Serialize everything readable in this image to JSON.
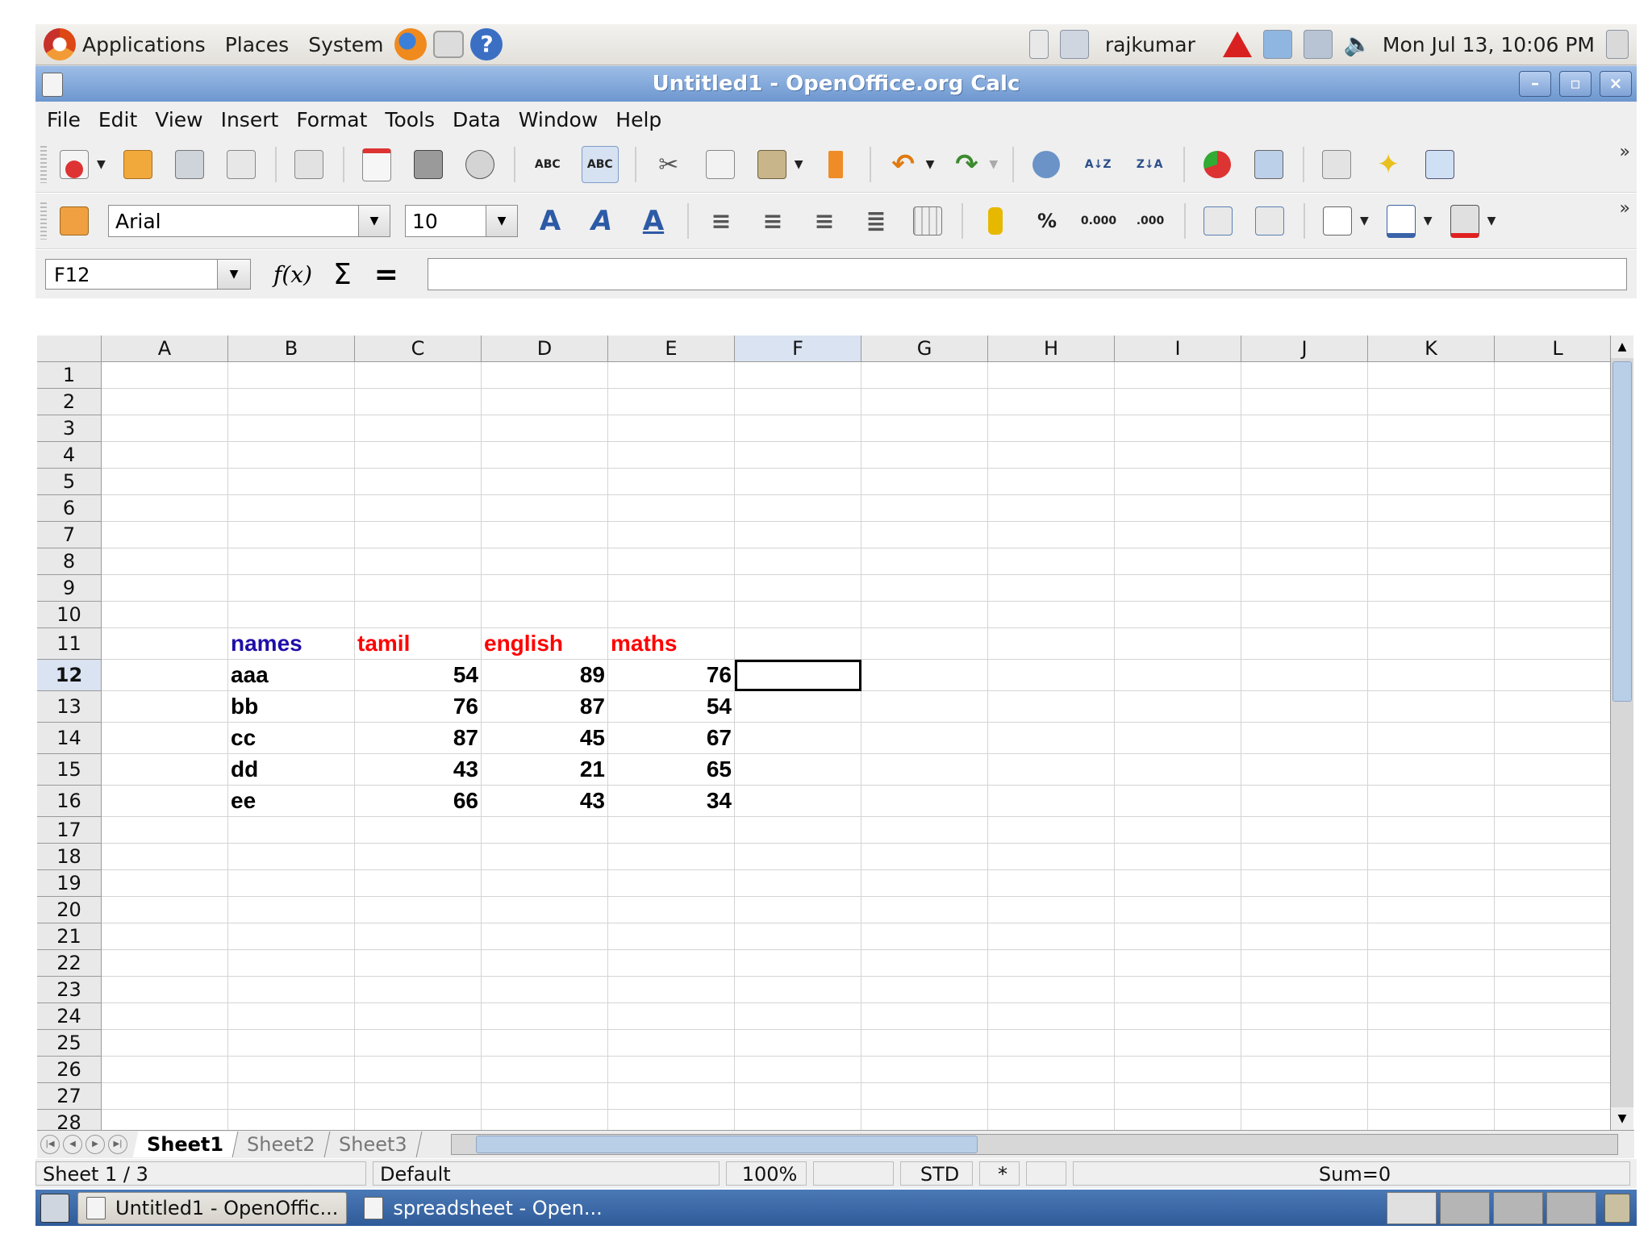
{
  "top_panel": {
    "menus": [
      "Applications",
      "Places",
      "System"
    ],
    "username": "rajkumar",
    "datetime": "Mon Jul 13, 10:06 PM",
    "launcher_icons": [
      "firefox-icon",
      "mail-icon",
      "help-icon"
    ],
    "tray_icons": [
      "network-manager-icon",
      "notes-icon",
      "warning-icon",
      "update-icon",
      "network-icon",
      "volume-icon",
      "logout-icon"
    ]
  },
  "window": {
    "title": "Untitled1 - OpenOffice.org Calc",
    "controls": [
      "minimize",
      "maximize",
      "close"
    ]
  },
  "menu_bar": [
    "File",
    "Edit",
    "View",
    "Insert",
    "Format",
    "Tools",
    "Data",
    "Window",
    "Help"
  ],
  "toolbar": {
    "font_name": "Arial",
    "font_size": "10",
    "percent_symbol": "%"
  },
  "formula_bar": {
    "name_box": "F12",
    "function_wizard": "f(x)",
    "sum_symbol": "Σ",
    "equals_symbol": "=",
    "formula_value": ""
  },
  "sheet": {
    "columns": [
      "A",
      "B",
      "C",
      "D",
      "E",
      "F",
      "G",
      "H",
      "I",
      "J",
      "K",
      "L"
    ],
    "active_column": "F",
    "rows": [
      "1",
      "2",
      "3",
      "4",
      "5",
      "6",
      "7",
      "8",
      "9",
      "10",
      "11",
      "12",
      "13",
      "14",
      "15",
      "16",
      "17",
      "18",
      "19",
      "20",
      "21",
      "22",
      "23",
      "24",
      "25",
      "26",
      "27",
      "28"
    ],
    "active_row": "12",
    "active_cell": "F12",
    "table": {
      "headers": [
        "names",
        "tamil",
        "english",
        "maths"
      ],
      "header_colors": [
        "#1f0ea8",
        "#ff0000",
        "#ff0000",
        "#ff0000"
      ],
      "data": [
        [
          "aaa",
          "54",
          "89",
          "76"
        ],
        [
          "bb",
          "76",
          "87",
          "54"
        ],
        [
          "cc",
          "87",
          "45",
          "67"
        ],
        [
          "dd",
          "43",
          "21",
          "65"
        ],
        [
          "ee",
          "66",
          "43",
          "34"
        ]
      ]
    }
  },
  "sheet_tabs": [
    "Sheet1",
    "Sheet2",
    "Sheet3"
  ],
  "active_tab": "Sheet1",
  "status_bar": {
    "sheet": "Sheet 1 / 3",
    "page_style": "Default",
    "zoom": "100%",
    "selection_mode": "STD",
    "modified": "*",
    "sum": "Sum=0"
  },
  "taskbar": {
    "tasks": [
      "Untitled1 - OpenOffic...",
      "spreadsheet - Open..."
    ]
  }
}
